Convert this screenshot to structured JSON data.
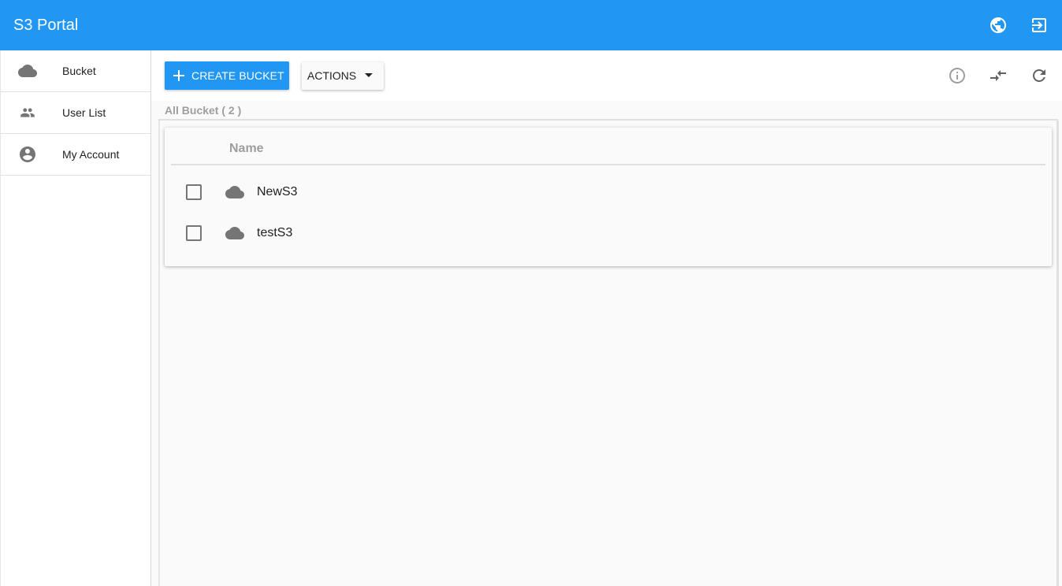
{
  "appbar": {
    "title": "S3 Portal",
    "icons": [
      "globe-icon",
      "exit-icon"
    ]
  },
  "sidebar": {
    "items": [
      {
        "label": "Bucket",
        "icon": "cloud-icon"
      },
      {
        "label": "User List",
        "icon": "people-icon"
      },
      {
        "label": "My Account",
        "icon": "account-circle-icon"
      }
    ]
  },
  "toolbar": {
    "create_label": "CREATE BUCKET",
    "actions_label": "ACTIONS",
    "right_icons": [
      "info-icon",
      "compare-arrows-icon",
      "refresh-icon"
    ]
  },
  "bucket_list": {
    "header": "All Bucket ( 2 )",
    "column_name": "Name",
    "rows": [
      {
        "name": "NewS3",
        "checked": false
      },
      {
        "name": "testS3",
        "checked": false
      }
    ]
  },
  "colors": {
    "primary": "#2196f3",
    "icon_gray": "#757575",
    "muted_text": "#9e9e9e"
  }
}
